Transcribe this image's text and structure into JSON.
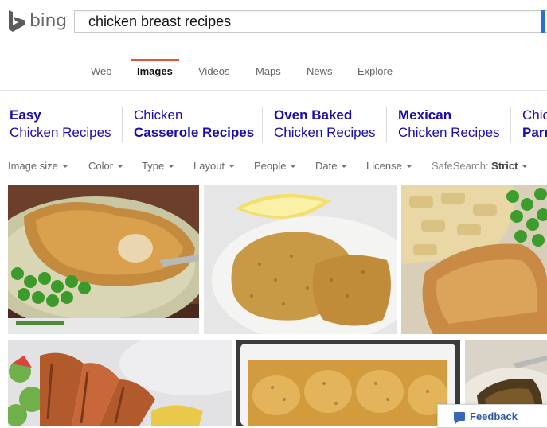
{
  "brand": {
    "name": "bing"
  },
  "search": {
    "query": "chicken breast recipes"
  },
  "tabs": [
    {
      "label": "Web"
    },
    {
      "label": "Images"
    },
    {
      "label": "Videos"
    },
    {
      "label": "Maps"
    },
    {
      "label": "News"
    },
    {
      "label": "Explore"
    }
  ],
  "related": [
    {
      "line1": "Easy",
      "line2": "Chicken Recipes"
    },
    {
      "line1": "Chicken",
      "line2": "Casserole Recipes"
    },
    {
      "line1": "Oven Baked",
      "line2": "Chicken Recipes"
    },
    {
      "line1": "Mexican",
      "line2": "Chicken Recipes"
    },
    {
      "line1": "Chic",
      "line2": "Parm"
    }
  ],
  "filters": {
    "image_size": "Image size",
    "color": "Color",
    "type": "Type",
    "layout": "Layout",
    "people": "People",
    "date": "Date",
    "license": "License",
    "safesearch_label": "SafeSearch:",
    "safesearch_value": "Strict"
  },
  "feedback": {
    "label": "Feedback"
  },
  "colors": {
    "accent_tab": "#e3543b",
    "link": "#1a0dab",
    "search_button": "#2d6fd8"
  }
}
